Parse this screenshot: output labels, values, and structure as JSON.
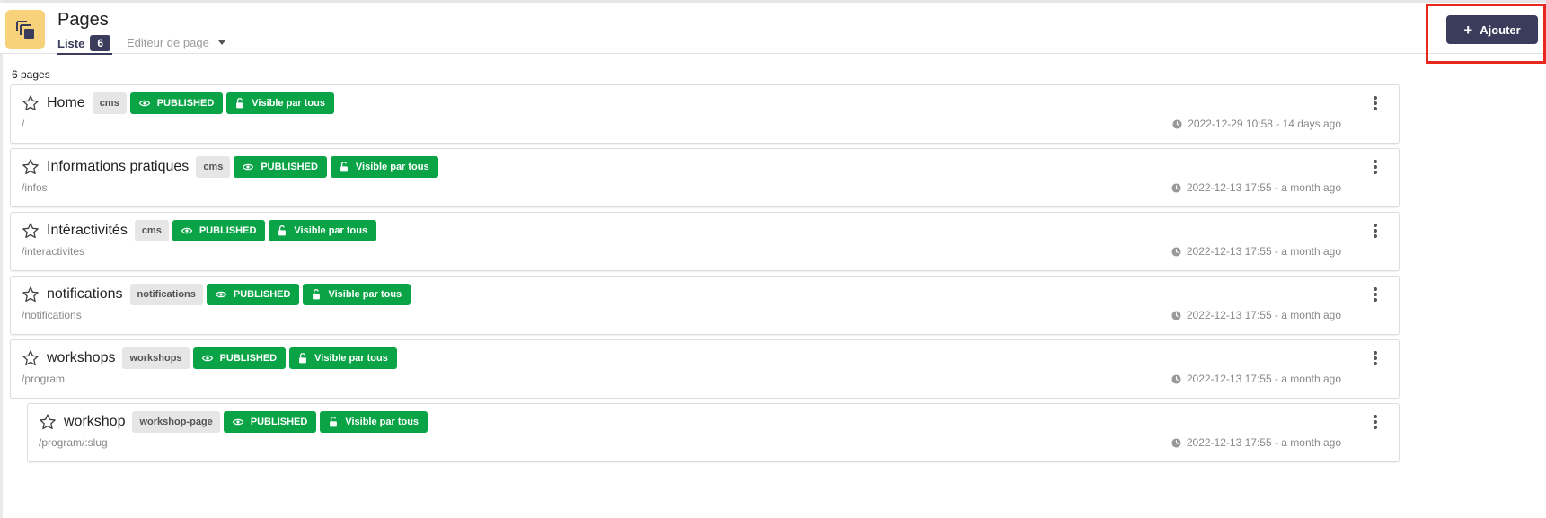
{
  "header": {
    "title": "Pages",
    "tabs": {
      "liste_label": "Liste",
      "liste_count": "6",
      "editeur_label": "Editeur de page"
    },
    "add_button_label": "Ajouter",
    "app_icon": "pages-stack-icon"
  },
  "summary": {
    "count_label": "6 pages"
  },
  "colors": {
    "primary": "#3b3b5c",
    "published_green": "#0aa447",
    "app_icon_bg": "#f7d27a",
    "highlight_red": "#e8281f"
  },
  "rows": [
    {
      "title": "Home",
      "tag": "cms",
      "status": "PUBLISHED",
      "visibility": "Visible par tous",
      "path": "/",
      "date": "2022-12-29 10:58 - 14 days ago"
    },
    {
      "title": "Informations pratiques",
      "tag": "cms",
      "status": "PUBLISHED",
      "visibility": "Visible par tous",
      "path": "/infos",
      "date": "2022-12-13 17:55 - a month ago"
    },
    {
      "title": "Intéractivités",
      "tag": "cms",
      "status": "PUBLISHED",
      "visibility": "Visible par tous",
      "path": "/interactivites",
      "date": "2022-12-13 17:55 - a month ago"
    },
    {
      "title": "notifications",
      "tag": "notifications",
      "status": "PUBLISHED",
      "visibility": "Visible par tous",
      "path": "/notifications",
      "date": "2022-12-13 17:55 - a month ago"
    },
    {
      "title": "workshops",
      "tag": "workshops",
      "status": "PUBLISHED",
      "visibility": "Visible par tous",
      "path": "/program",
      "date": "2022-12-13 17:55 - a month ago"
    },
    {
      "title": "workshop",
      "tag": "workshop-page",
      "status": "PUBLISHED",
      "visibility": "Visible par tous",
      "path": "/program/:slug",
      "date": "2022-12-13 17:55 - a month ago"
    }
  ]
}
